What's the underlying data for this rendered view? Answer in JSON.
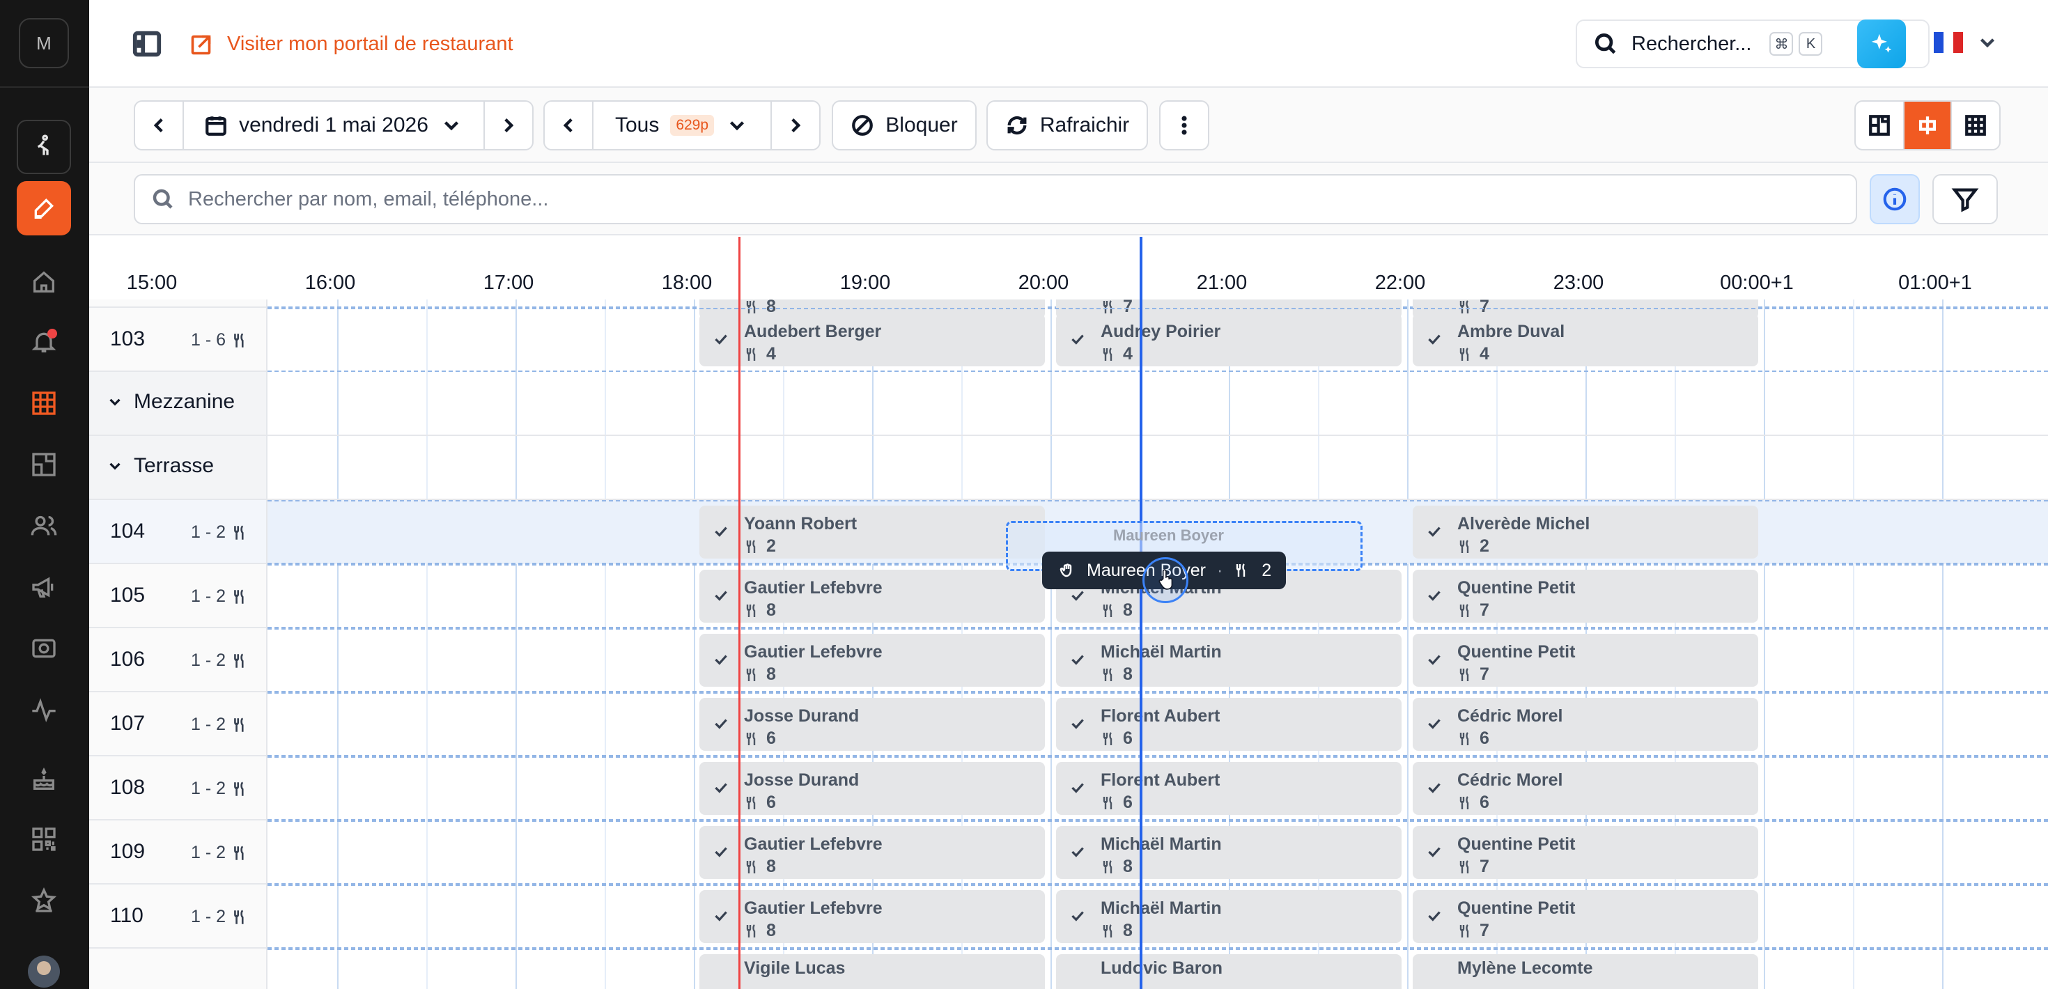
{
  "sidebar": {
    "logo_letter": "M",
    "items": [
      {
        "icon": "walking-person-icon",
        "name": "sidebar-item-walkin"
      },
      {
        "icon": "pencil-icon",
        "name": "sidebar-item-edit"
      },
      {
        "icon": "home-icon",
        "name": "sidebar-item-home"
      },
      {
        "icon": "bell-icon",
        "name": "sidebar-item-notifications"
      },
      {
        "icon": "grid-icon",
        "name": "sidebar-item-timeline"
      },
      {
        "icon": "floorplan-icon",
        "name": "sidebar-item-floorplan"
      },
      {
        "icon": "users-icon",
        "name": "sidebar-item-guests"
      },
      {
        "icon": "megaphone-icon",
        "name": "sidebar-item-marketing"
      },
      {
        "icon": "camera-icon",
        "name": "sidebar-item-camera"
      },
      {
        "icon": "activity-icon",
        "name": "sidebar-item-stats"
      },
      {
        "icon": "cake-icon",
        "name": "sidebar-item-events"
      },
      {
        "icon": "qr-code-icon",
        "name": "sidebar-item-qr"
      },
      {
        "icon": "star-gear-icon",
        "name": "sidebar-item-reviews"
      }
    ]
  },
  "header": {
    "portal_link": "Visiter mon portail de restaurant",
    "search_label": "Rechercher...",
    "kbd_cmd": "⌘",
    "kbd_k": "K",
    "colors": {
      "accent": "#f15a22",
      "ai": "#0ea5e9"
    }
  },
  "toolbar": {
    "date": "vendredi 1 mai 2026",
    "filter": "Tous",
    "filter_badge": "629p",
    "block": "Bloquer",
    "refresh": "Rafraichir"
  },
  "search": {
    "placeholder": "Rechercher par nom, email, téléphone..."
  },
  "timeline": {
    "hours": [
      "15:00",
      "16:00",
      "17:00",
      "18:00",
      "19:00",
      "20:00",
      "21:00",
      "22:00",
      "23:00",
      "00:00+1",
      "01:00+1"
    ]
  },
  "rows": {
    "r103": {
      "num": "103",
      "cap": "1 - 6"
    },
    "mezzanine": "Mezzanine",
    "terrasse": "Terrasse",
    "r104": {
      "num": "104",
      "cap": "1 - 2"
    },
    "r105": {
      "num": "105",
      "cap": "1 - 2"
    },
    "r106": {
      "num": "106",
      "cap": "1 - 2"
    },
    "r107": {
      "num": "107",
      "cap": "1 - 2"
    },
    "r108": {
      "num": "108",
      "cap": "1 - 2"
    },
    "r109": {
      "num": "109",
      "cap": "1 - 2"
    },
    "r110": {
      "num": "110",
      "cap": "1 - 2"
    }
  },
  "reservations": {
    "r103": [
      {
        "name": "Audebert Berger",
        "covers": "4"
      },
      {
        "name": "Audrey Poirier",
        "covers": "4"
      },
      {
        "name": "Ambre Duval",
        "covers": "4"
      }
    ],
    "r104": [
      {
        "name": "Yoann Robert",
        "covers": "2"
      },
      {
        "name": "Alverède Michel",
        "covers": "2"
      }
    ],
    "r105": [
      {
        "name": "Gautier Lefebvre",
        "covers": "8"
      },
      {
        "name": "Michaël Martin",
        "covers": "8"
      },
      {
        "name": "Quentine Petit",
        "covers": "7"
      }
    ],
    "r106": [
      {
        "name": "Gautier Lefebvre",
        "covers": "8"
      },
      {
        "name": "Michaël Martin",
        "covers": "8"
      },
      {
        "name": "Quentine Petit",
        "covers": "7"
      }
    ],
    "r107": [
      {
        "name": "Josse Durand",
        "covers": "6"
      },
      {
        "name": "Florent Aubert",
        "covers": "6"
      },
      {
        "name": "Cédric Morel",
        "covers": "6"
      }
    ],
    "r108": [
      {
        "name": "Josse Durand",
        "covers": "6"
      },
      {
        "name": "Florent Aubert",
        "covers": "6"
      },
      {
        "name": "Cédric Morel",
        "covers": "6"
      }
    ],
    "r109": [
      {
        "name": "Gautier Lefebvre",
        "covers": "8"
      },
      {
        "name": "Michaël Martin",
        "covers": "8"
      },
      {
        "name": "Quentine Petit",
        "covers": "7"
      }
    ],
    "r110": [
      {
        "name": "Gautier Lefebvre",
        "covers": "8"
      },
      {
        "name": "Michaël Martin",
        "covers": "8"
      },
      {
        "name": "Quentine Petit",
        "covers": "7"
      }
    ],
    "r111": [
      {
        "name": "Vigile Lucas"
      },
      {
        "name": "Ludovic Baron"
      },
      {
        "name": "Mylène Lecomte"
      }
    ],
    "r102": [
      {
        "covers": "8"
      },
      {
        "covers": "7"
      },
      {
        "covers": "7"
      }
    ]
  },
  "drag": {
    "name": "Maureen Boyer",
    "covers": "2",
    "ghost_name": "Maureen Boyer",
    "separator": "·"
  }
}
